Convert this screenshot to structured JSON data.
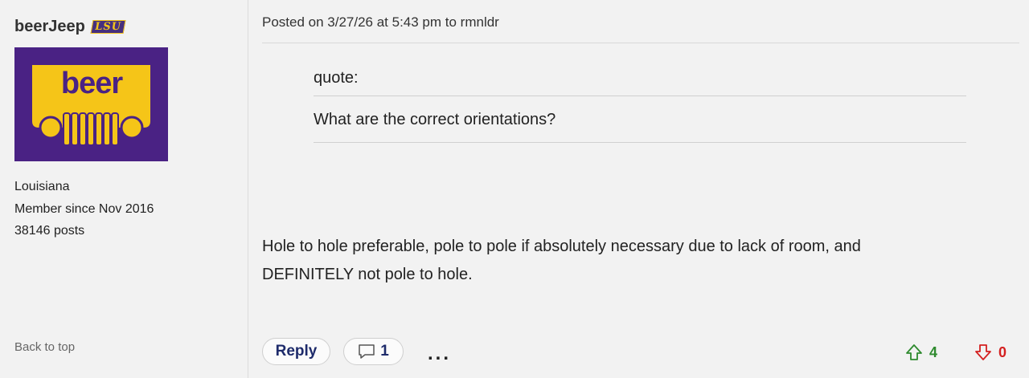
{
  "author": {
    "username": "beerJeep",
    "team_badge": "LSU",
    "avatar_text": "beer",
    "location": "Louisiana",
    "member_since": "Member since Nov 2016",
    "posts": "38146 posts"
  },
  "sidebar": {
    "back_to_top": "Back to top"
  },
  "post": {
    "header": "Posted on 3/27/26 at 5:43 pm to rmnldr",
    "quote_label": "quote:",
    "quote_text": "What are the correct orientations?",
    "body_line1": "Hole to hole preferable, pole to pole if absolutely necessary due to lack of room, and",
    "body_line2": "DEFINITELY not pole to hole."
  },
  "actions": {
    "reply_label": "Reply",
    "comment_count": "1",
    "more_label": "..."
  },
  "votes": {
    "up": "4",
    "down": "0"
  },
  "colors": {
    "avatar_bg": "#4a2284",
    "avatar_fg": "#f5c518",
    "upvote": "#2e8a2e",
    "downvote": "#d42020",
    "reply_text": "#1e2b6b"
  }
}
